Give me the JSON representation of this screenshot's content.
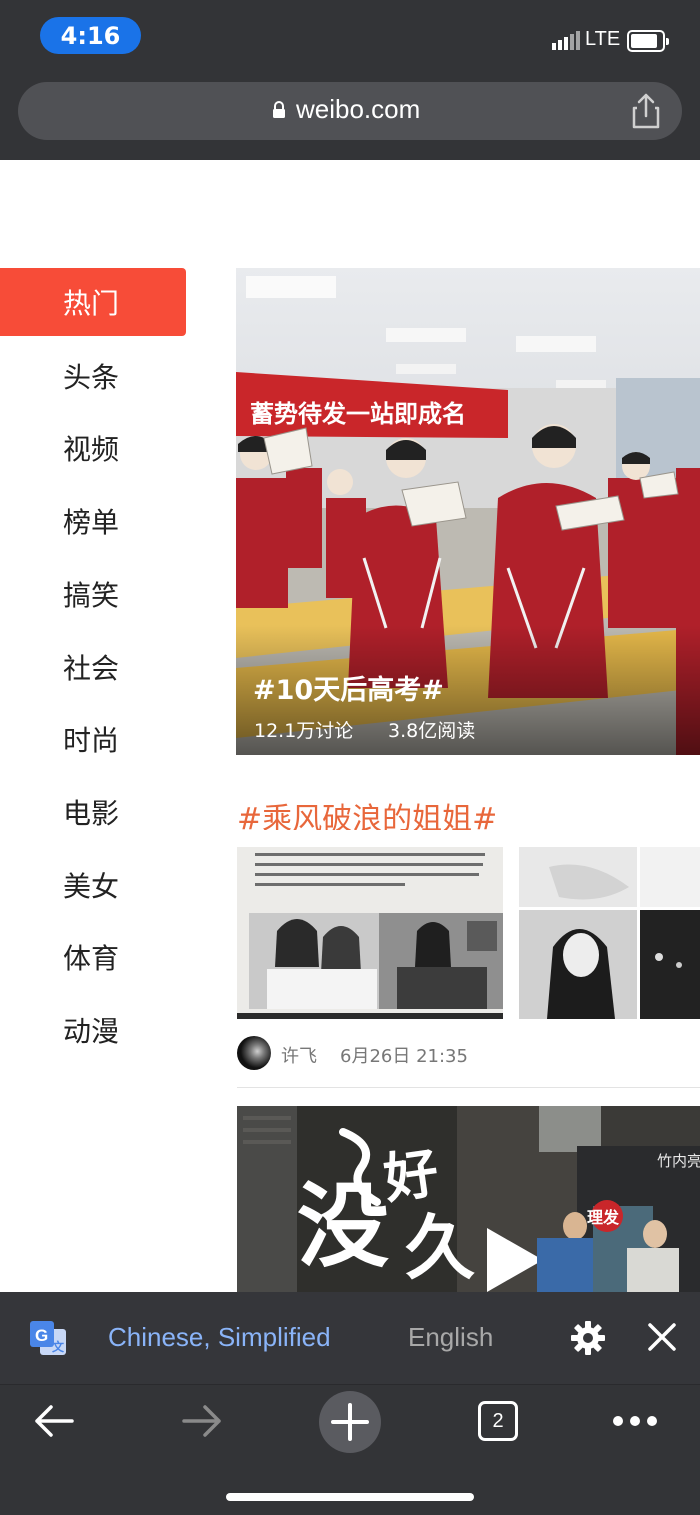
{
  "status_bar": {
    "time": "4:16",
    "network": "LTE"
  },
  "browser": {
    "url": "weibo.com"
  },
  "sidebar": {
    "items": [
      {
        "label": "热门",
        "active": true
      },
      {
        "label": "头条"
      },
      {
        "label": "视频"
      },
      {
        "label": "榜单"
      },
      {
        "label": "搞笑"
      },
      {
        "label": "社会"
      },
      {
        "label": "时尚"
      },
      {
        "label": "电影"
      },
      {
        "label": "美女"
      },
      {
        "label": "体育"
      },
      {
        "label": "动漫"
      }
    ]
  },
  "feed": {
    "hero": {
      "title": "#10天后高考#",
      "discussions": "12.1万讨论",
      "reads": "3.8亿阅读",
      "banner_text": "蓄势待发一站即成名"
    },
    "topic": {
      "title": "#乘风破浪的姐姐#",
      "author": "许飞",
      "time": "6月26日 21:35"
    },
    "video": {
      "calligraphy": [
        "好",
        "久",
        "没"
      ],
      "shop_sign": "竹内亮",
      "shop_badge": "理发"
    }
  },
  "translate_bar": {
    "source_language": "Chinese, Simplified",
    "target_language": "English"
  },
  "toolbar": {
    "tab_count": "2"
  },
  "colors": {
    "accent_red": "#f74c38",
    "topic_orange": "#e8673b",
    "chrome_dark": "#333437",
    "link_blue": "#8ab4f8",
    "time_pill_blue": "#1a73e8"
  }
}
